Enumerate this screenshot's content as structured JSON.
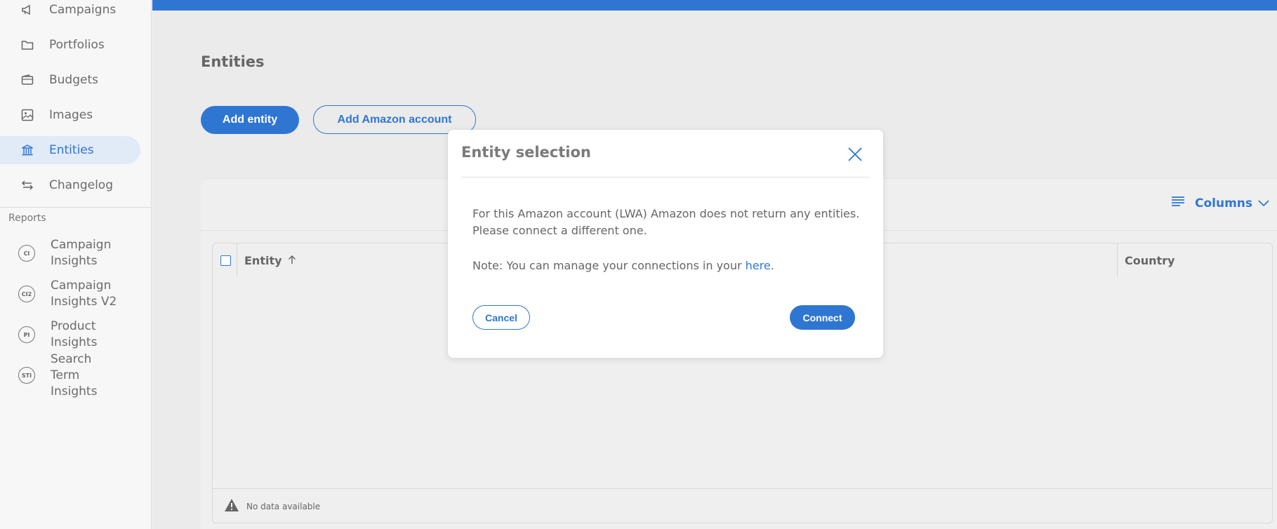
{
  "sidebar": {
    "items": [
      {
        "label": "Campaigns",
        "icon": "megaphone-icon"
      },
      {
        "label": "Portfolios",
        "icon": "folder-icon"
      },
      {
        "label": "Budgets",
        "icon": "wallet-icon"
      },
      {
        "label": "Images",
        "icon": "image-icon"
      },
      {
        "label": "Entities",
        "icon": "bank-icon",
        "active": true
      },
      {
        "label": "Changelog",
        "icon": "swap-arrows-icon"
      }
    ],
    "section_label": "Reports",
    "reports": [
      {
        "badge": "CI",
        "label": "Campaign Insights"
      },
      {
        "badge": "CI2",
        "label": "Campaign Insights V2"
      },
      {
        "badge": "PI",
        "label": "Product Insights"
      },
      {
        "badge": "STI",
        "label": "Search Term Insights"
      }
    ]
  },
  "main": {
    "title": "Entities",
    "add_entity_label": "Add entity",
    "add_amazon_label": "Add Amazon account",
    "columns_label": "Columns",
    "table": {
      "headers": [
        "Entity",
        "Country"
      ],
      "empty_message": "No data available"
    }
  },
  "modal": {
    "title": "Entity selection",
    "message": "For this Amazon account (LWA) Amazon does not return any entities. Please connect a different one.",
    "note_prefix": "Note: You can manage your connections in your ",
    "note_link": "here",
    "note_suffix": ".",
    "cancel_label": "Cancel",
    "connect_label": "Connect"
  },
  "colors": {
    "accent": "#2f76d3",
    "active_bg": "#e1eaf7"
  }
}
